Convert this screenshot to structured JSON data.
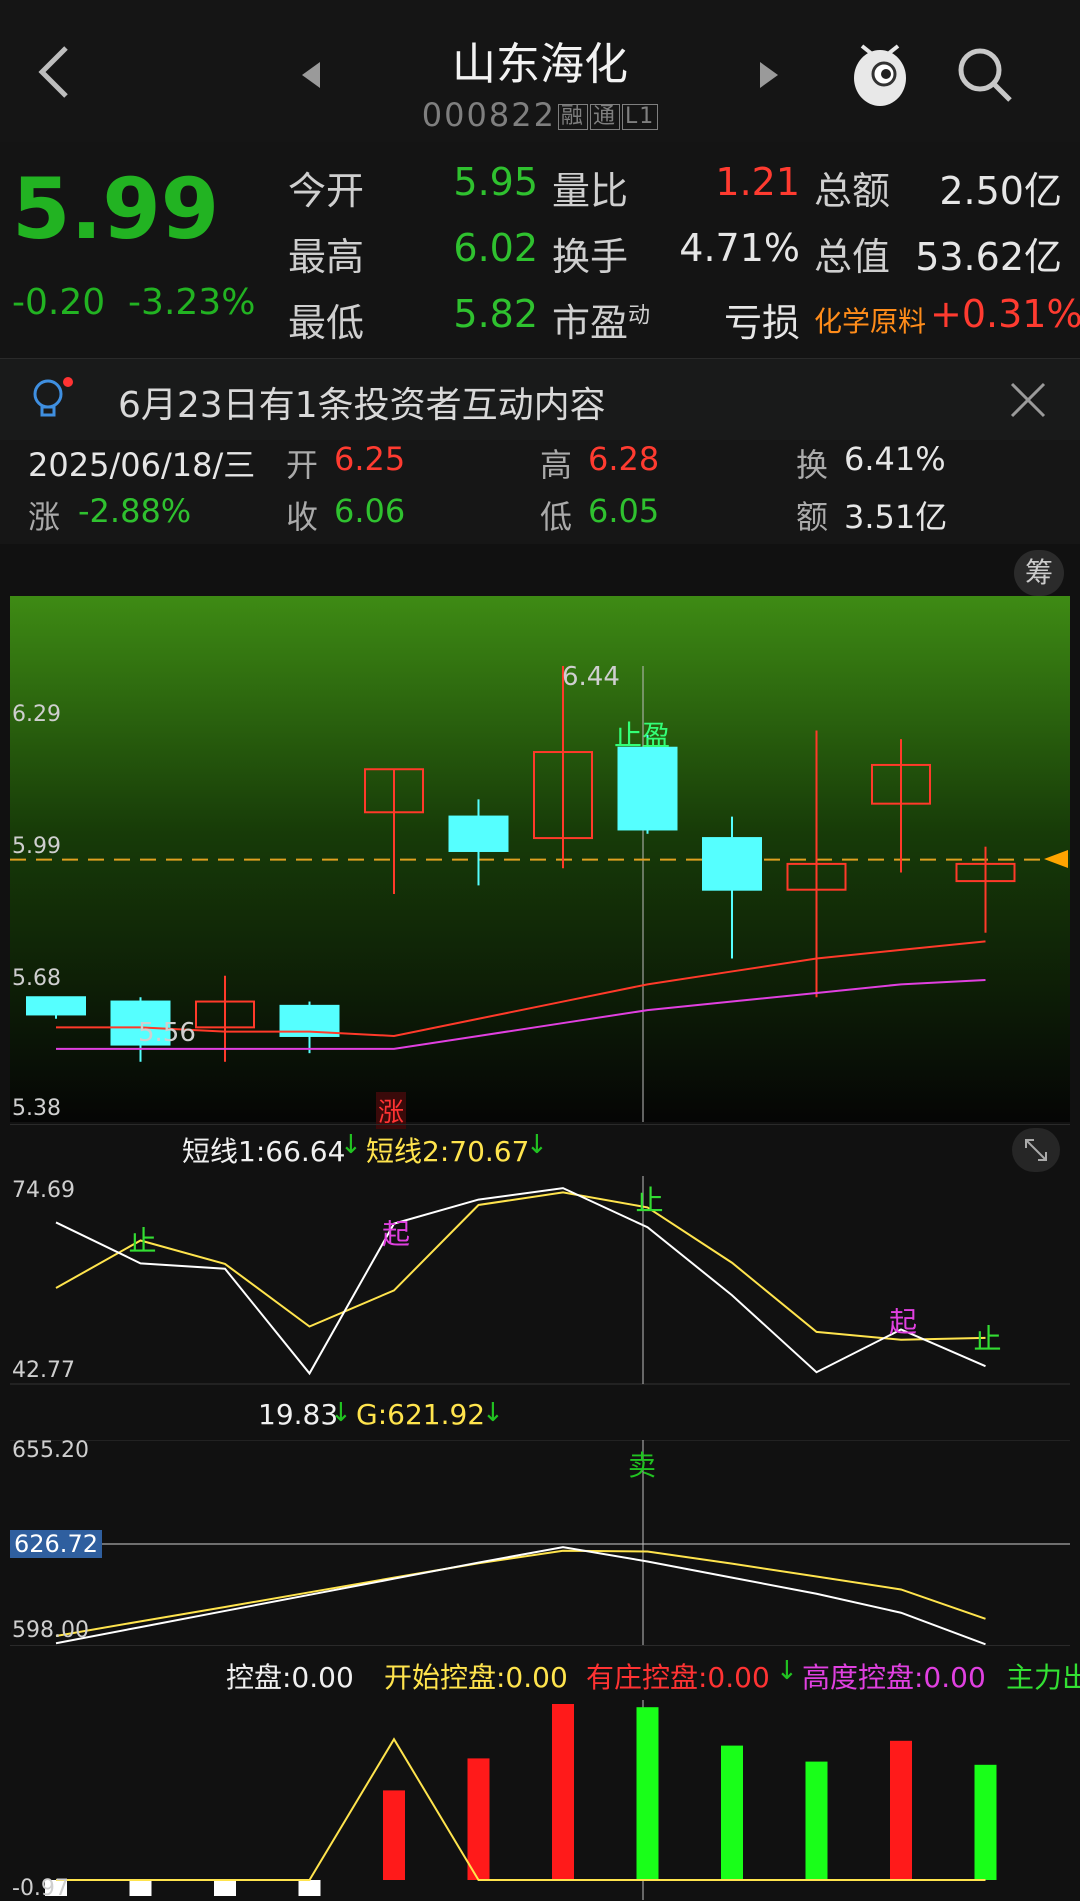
{
  "header": {
    "back_icon": "chevron-left-icon",
    "prev_icon": "triangle-left-icon",
    "next_icon": "triangle-right-icon",
    "title": "山东海化",
    "code": "000822",
    "badges": [
      "融",
      "通",
      "L1"
    ],
    "mascot_icon": "mascot-icon",
    "search_icon": "search-icon"
  },
  "quote": {
    "price": "5.99",
    "change": "-0.20",
    "change_pct": "-3.23%",
    "rows": [
      {
        "l1": "今开",
        "v1": "5.95",
        "l2": "量比",
        "v2": "1.21",
        "l3": "总额",
        "v3": "2.50亿"
      },
      {
        "l1": "最高",
        "v1": "6.02",
        "l2": "换手",
        "v2": "4.71%",
        "l3": "总值",
        "v3": "53.62亿"
      },
      {
        "l1": "最低",
        "v1": "5.82",
        "l2": "市盈",
        "l2_sup": "动",
        "v2": "亏损",
        "l3": "化学原料",
        "v3": "+0.31%"
      }
    ]
  },
  "notice": {
    "text": "6月23日有1条投资者互动内容",
    "bulb_icon": "lightbulb-icon",
    "close_icon": "close-icon"
  },
  "ohlc": {
    "date": "2025/06/18/三",
    "open_label": "开",
    "open": "6.25",
    "high_label": "高",
    "high": "6.28",
    "turn_label": "换",
    "turn": "6.41%",
    "chg_label": "涨",
    "chg": "-2.88%",
    "close_label": "收",
    "close": "6.06",
    "low_label": "低",
    "low": "6.05",
    "amt_label": "额",
    "amt": "3.51亿"
  },
  "main_chart": {
    "chip_button": "筹",
    "axis": [
      "6.29",
      "5.99",
      "5.68",
      "5.38"
    ],
    "peak_label": "6.44",
    "low_label": "5.56",
    "stop_label": "止盈",
    "rise_label": "涨",
    "ymin": 5.38,
    "ymax": 6.44,
    "candles": [
      {
        "o": 5.67,
        "c": 5.63,
        "h": 5.67,
        "l": 5.62
      },
      {
        "o": 5.66,
        "c": 5.56,
        "h": 5.67,
        "l": 5.52
      },
      {
        "o": 5.6,
        "c": 5.66,
        "h": 5.72,
        "l": 5.52
      },
      {
        "o": 5.65,
        "c": 5.58,
        "h": 5.66,
        "l": 5.54
      },
      {
        "o": 6.1,
        "c": 6.2,
        "h": 6.2,
        "l": 5.91
      },
      {
        "o": 6.09,
        "c": 6.01,
        "h": 6.13,
        "l": 5.93
      },
      {
        "o": 6.04,
        "c": 6.24,
        "h": 6.44,
        "l": 5.97
      },
      {
        "o": 6.25,
        "c": 6.06,
        "h": 6.28,
        "l": 6.05
      },
      {
        "o": 6.04,
        "c": 5.92,
        "h": 6.09,
        "l": 5.76
      },
      {
        "o": 5.92,
        "c": 5.98,
        "h": 6.29,
        "l": 5.67
      },
      {
        "o": 6.12,
        "c": 6.21,
        "h": 6.27,
        "l": 5.96
      },
      {
        "o": 5.94,
        "c": 5.98,
        "h": 6.02,
        "l": 5.82
      }
    ],
    "current_price": 5.99
  },
  "short_panel": {
    "label1": "短线1:66.64",
    "label2": "短线2:70.67",
    "axis_top": "74.69",
    "axis_bottom": "42.77",
    "expand_icon": "expand-icon",
    "ymin": 42.77,
    "ymax": 74.69,
    "line1": [
      68.3,
      61.5,
      60.6,
      43.2,
      68.1,
      72.1,
      74.0,
      67.5,
      56.2,
      43.4,
      50.5,
      44.4
    ],
    "line2": [
      57.4,
      65.3,
      61.4,
      51.0,
      57.0,
      71.2,
      73.3,
      70.8,
      61.6,
      50.1,
      48.8,
      49.1
    ],
    "tags": [
      {
        "i": 1,
        "t": "止",
        "v": 65.3
      },
      {
        "i": 4,
        "t": "起",
        "v": 66.5
      },
      {
        "i": 7,
        "t": "止",
        "v": 72.0
      },
      {
        "i": 10,
        "t": "起",
        "v": 51.8
      },
      {
        "i": 11,
        "t": "止",
        "v": 49.0
      }
    ]
  },
  "g_panel": {
    "label1": "19.83",
    "label2": "G:621.92",
    "axis_top": "655.20",
    "axis_mid": "626.72",
    "axis_bottom": "598.00",
    "sell_label": "卖",
    "ymin": 598.0,
    "ymax": 655.2,
    "white": [
      598.5,
      603.0,
      607.5,
      612.0,
      616.5,
      621.0,
      625.3,
      621.3,
      616.8,
      612.3,
      607.0,
      598.2
    ],
    "yellow": [
      600.5,
      604.6,
      608.6,
      612.7,
      616.8,
      620.8,
      624.3,
      624.1,
      620.7,
      617.1,
      613.5,
      605.3
    ]
  },
  "bottom_panel": {
    "label_a": "控盘:0.00",
    "label_b": "开始控盘:0.00",
    "label_c": "有庄控盘:0.00",
    "label_d": "高度控盘:0.00",
    "label_e": "主力出",
    "axis_bottom": "-0.97",
    "bars": [
      {
        "v": 0,
        "c": "#ffffff"
      },
      {
        "v": 0,
        "c": "#ffffff"
      },
      {
        "v": 0,
        "c": "#ffffff"
      },
      {
        "v": 0,
        "c": "#ffffff"
      },
      {
        "v": 0.56,
        "c": "#ff1a1a"
      },
      {
        "v": 0.76,
        "c": "#ff1a1a"
      },
      {
        "v": 1.1,
        "c": "#ff1a1a"
      },
      {
        "v": 1.08,
        "c": "#19ff19"
      },
      {
        "v": 0.84,
        "c": "#19ff19"
      },
      {
        "v": 0.74,
        "c": "#19ff19"
      },
      {
        "v": 0.87,
        "c": "#ff1a1a"
      },
      {
        "v": 0.72,
        "c": "#19ff19"
      }
    ],
    "line": [
      0.0,
      0.0,
      0.0,
      0.0,
      0.88,
      0.0,
      0.0,
      0.0,
      0.0,
      0.0,
      0.0,
      0.0
    ]
  }
}
